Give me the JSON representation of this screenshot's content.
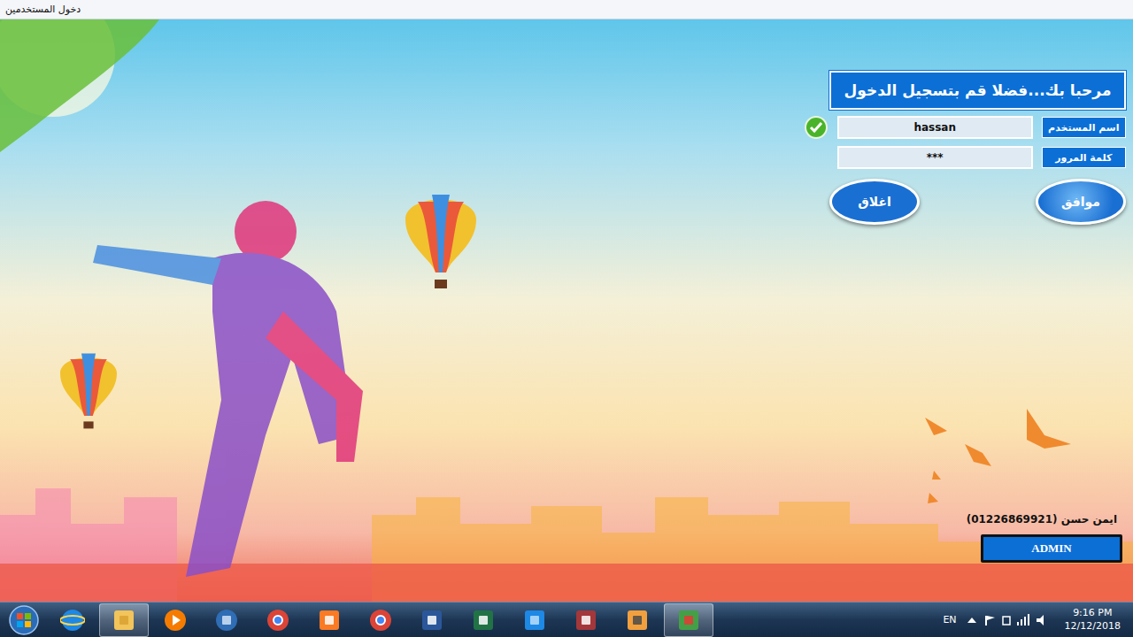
{
  "window": {
    "title": "دخول المستخدمين"
  },
  "login": {
    "heading": "مرحبا بك...فضلا قم بتسجيل الدخول",
    "fields": [
      {
        "label": "اسم المستخدم",
        "value": "hassan",
        "valid": true
      },
      {
        "label": "كلمة المرور",
        "value": "***",
        "valid": false
      }
    ],
    "buttons": [
      {
        "label": "موافق",
        "hovered": true
      },
      {
        "label": "اغلاق",
        "hovered": false
      }
    ]
  },
  "credit": "ايمن حسن (01226869921)",
  "admin_button": "ADMIN",
  "taskbar": {
    "language": "EN",
    "time": "9:16 PM",
    "date": "12/12/2018",
    "apps": [
      {
        "kind": "ie",
        "active": false
      },
      {
        "kind": "explorer",
        "active": true
      },
      {
        "kind": "media",
        "active": false
      },
      {
        "kind": "swirl",
        "active": false
      },
      {
        "kind": "chrome",
        "active": false
      },
      {
        "kind": "xampp",
        "active": false
      },
      {
        "kind": "chrome",
        "active": false
      },
      {
        "kind": "word",
        "active": false
      },
      {
        "kind": "excel",
        "active": false
      },
      {
        "kind": "capture",
        "active": false
      },
      {
        "kind": "access",
        "active": false
      },
      {
        "kind": "sublime",
        "active": false
      },
      {
        "kind": "cube",
        "active": true
      }
    ]
  }
}
